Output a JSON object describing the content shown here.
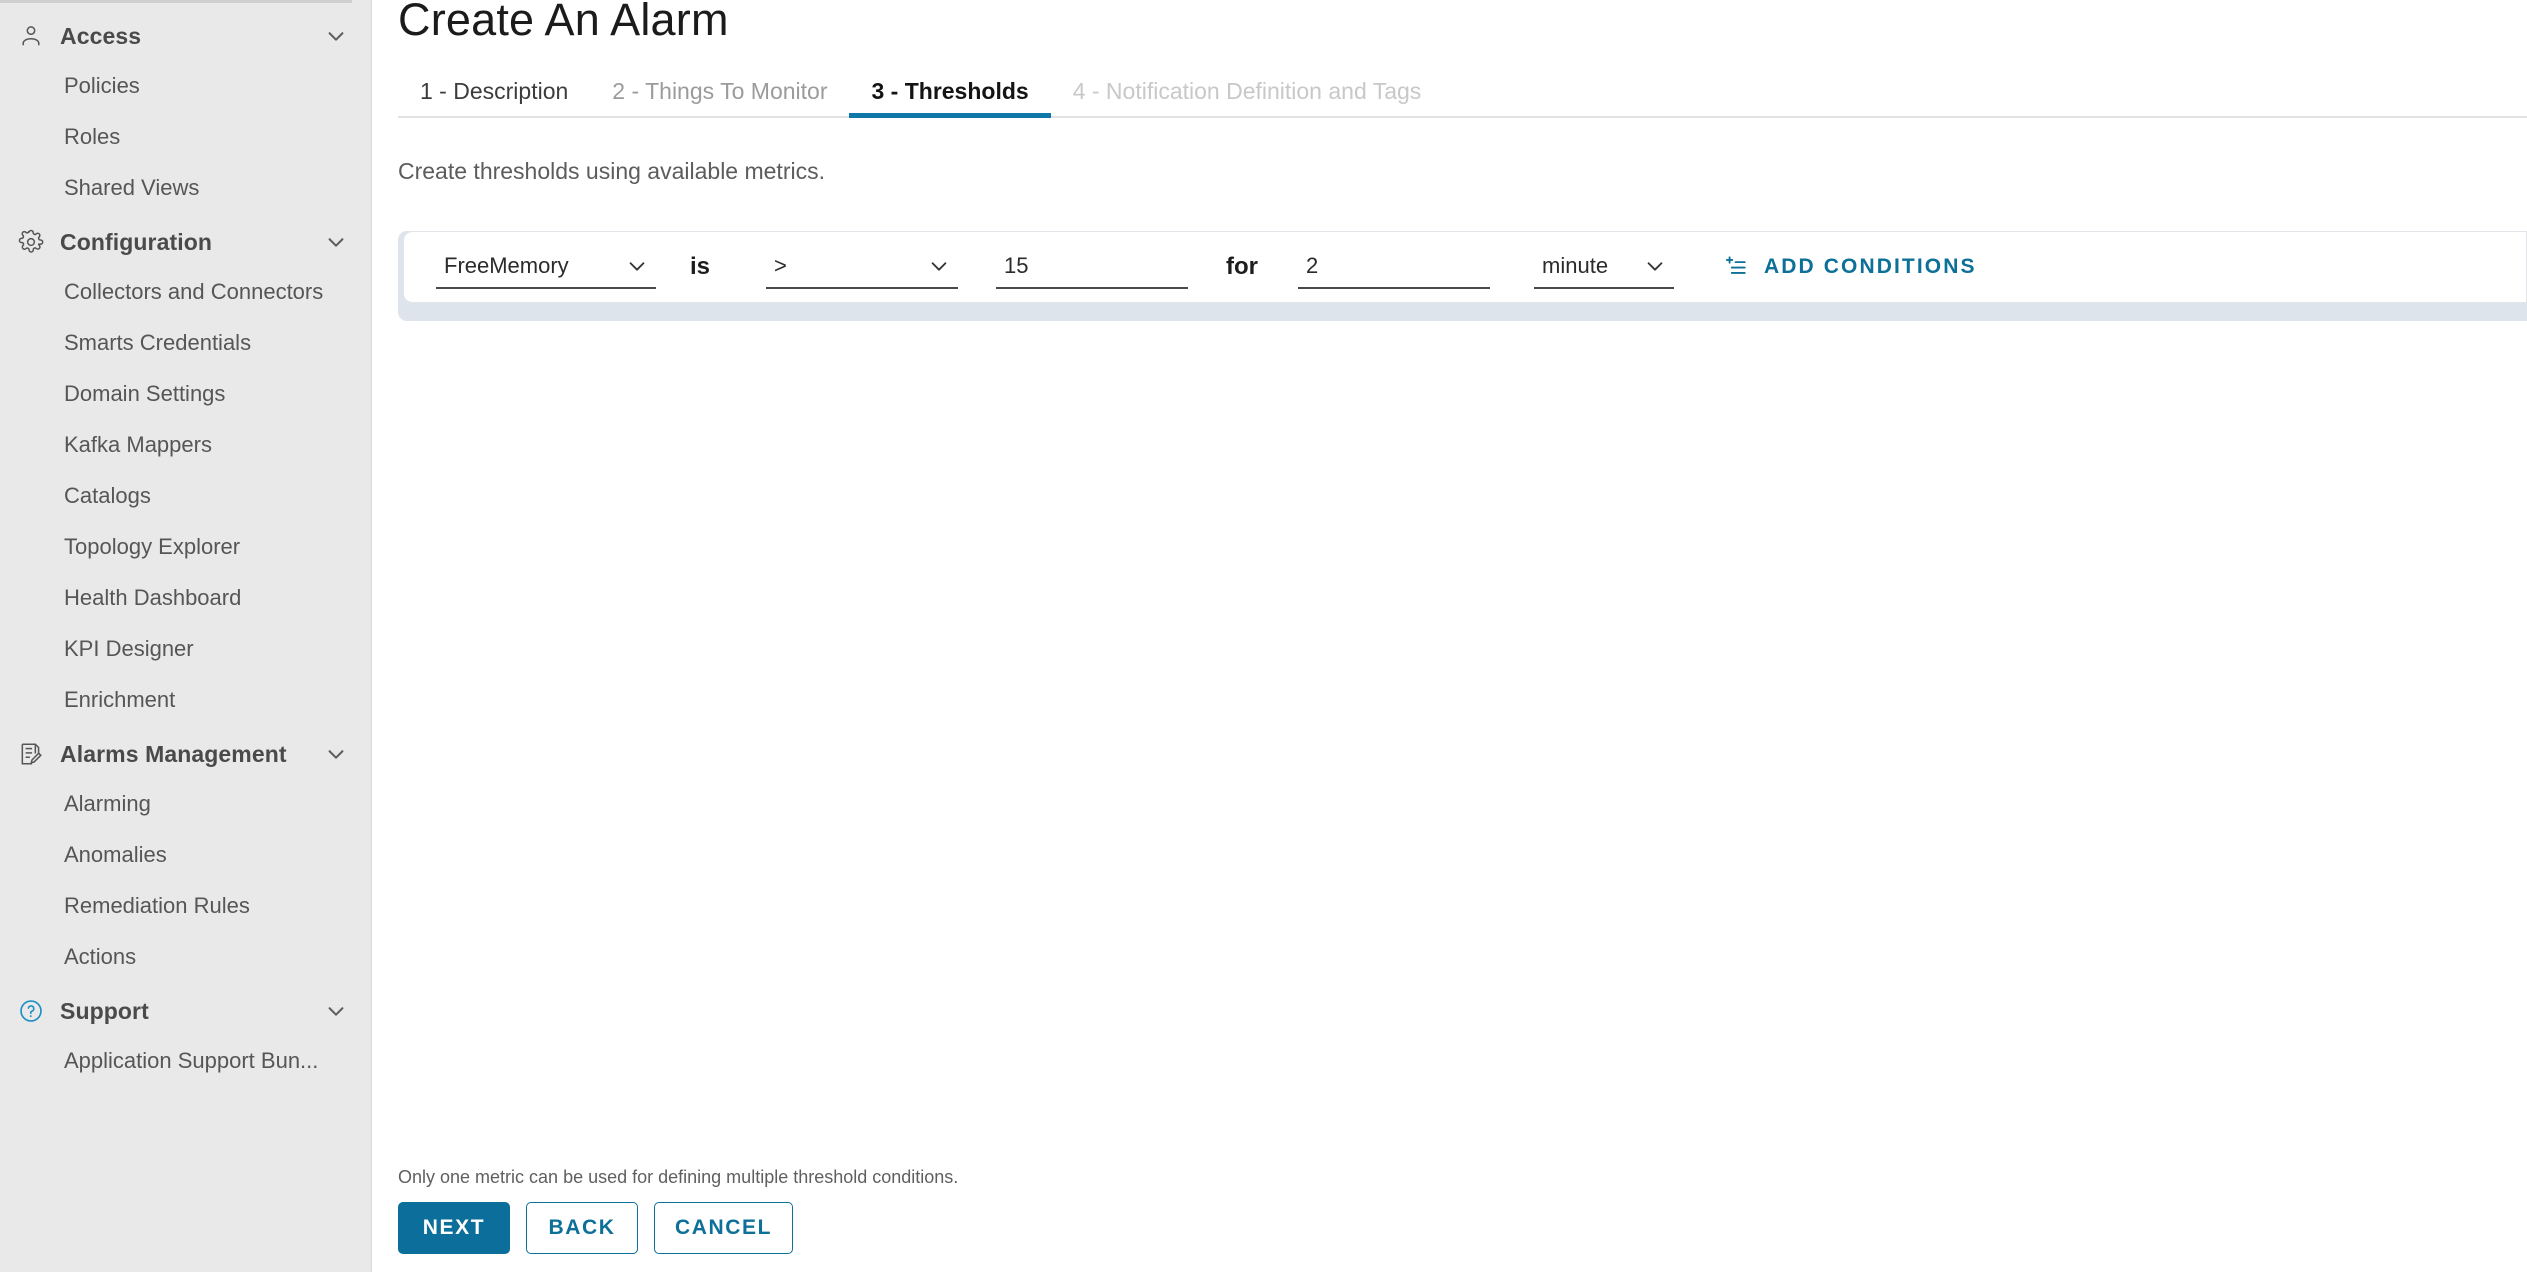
{
  "sidebar": {
    "groups": [
      {
        "id": "access",
        "label": "Access",
        "icon": "user-icon",
        "chevron": "chevron-down-icon",
        "items": [
          {
            "label": "Policies"
          },
          {
            "label": "Roles"
          },
          {
            "label": "Shared Views"
          }
        ]
      },
      {
        "id": "configuration",
        "label": "Configuration",
        "icon": "gear-icon",
        "chevron": "chevron-down-icon",
        "items": [
          {
            "label": "Collectors and Connectors"
          },
          {
            "label": "Smarts Credentials"
          },
          {
            "label": "Domain Settings"
          },
          {
            "label": "Kafka Mappers"
          },
          {
            "label": "Catalogs"
          },
          {
            "label": "Topology Explorer"
          },
          {
            "label": "Health Dashboard"
          },
          {
            "label": "KPI Designer"
          },
          {
            "label": "Enrichment"
          }
        ]
      },
      {
        "id": "alarms-management",
        "label": "Alarms Management",
        "icon": "note-edit-icon",
        "chevron": "chevron-down-icon",
        "items": [
          {
            "label": "Alarming"
          },
          {
            "label": "Anomalies"
          },
          {
            "label": "Remediation Rules"
          },
          {
            "label": "Actions"
          }
        ]
      },
      {
        "id": "support",
        "label": "Support",
        "icon": "help-circle-icon",
        "chevron": "chevron-down-icon",
        "items": [
          {
            "label": "Application Support Bun..."
          }
        ]
      }
    ]
  },
  "header": {
    "title": "Create An Alarm"
  },
  "tabs": [
    {
      "label": "1 - Description",
      "state": "visited"
    },
    {
      "label": "2 - Things To Monitor",
      "state": "muted"
    },
    {
      "label": "3 - Thresholds",
      "state": "active"
    },
    {
      "label": "4 - Notification Definition and Tags",
      "state": "disabled"
    }
  ],
  "main": {
    "instruction": "Create thresholds using available metrics.",
    "threshold": {
      "metric": {
        "value": "FreeMemory",
        "chevron": "chevron-down-icon"
      },
      "joiner_is": "is",
      "operator": {
        "value": ">",
        "chevron": "chevron-down-icon"
      },
      "threshold_value": "15",
      "joiner_for": "for",
      "duration": "2",
      "unit": {
        "value": "minute",
        "chevron": "chevron-down-icon"
      },
      "add_conditions": {
        "label": "ADD CONDITIONS",
        "icon": "add-list-icon"
      }
    }
  },
  "footer": {
    "note": "Only one metric can be used for defining multiple threshold conditions.",
    "buttons": [
      {
        "label": "NEXT",
        "style": "primary"
      },
      {
        "label": "BACK",
        "style": "outline"
      },
      {
        "label": "CANCEL",
        "style": "outline"
      }
    ]
  },
  "colors": {
    "accent": "#0c7098",
    "primary_button": "#0c6e9a",
    "active_tab_underline": "#0f78a8",
    "sidebar_bg": "#e9e9e9",
    "card_band": "#dde4eb"
  }
}
